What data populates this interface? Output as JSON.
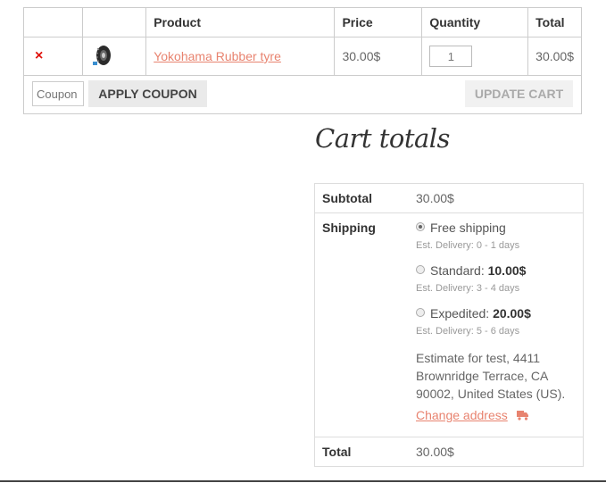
{
  "cart": {
    "headers": {
      "remove": "",
      "thumbnail": "",
      "product": "Product",
      "price": "Price",
      "quantity": "Quantity",
      "total": "Total"
    },
    "item": {
      "remove_symbol": "×",
      "thumbnail_icon": "tyre-icon",
      "product_name": "Yokohama Rubber tyre",
      "price": "30.00$",
      "quantity": "1",
      "total": "30.00$"
    },
    "actions": {
      "coupon_placeholder": "Coupon",
      "apply_coupon_label": "APPLY COUPON",
      "update_cart_label": "UPDATE CART"
    }
  },
  "totals": {
    "heading": "Cart totals",
    "subtotal_label": "Subtotal",
    "subtotal_value": "30.00$",
    "shipping_label": "Shipping",
    "shipping_options": [
      {
        "name": "Free shipping",
        "price": "",
        "delivery": "Est. Delivery: 0 - 1 days",
        "selected": true
      },
      {
        "name": "Standard:",
        "price": "10.00$",
        "delivery": "Est. Delivery: 3 - 4 days",
        "selected": false
      },
      {
        "name": "Expedited:",
        "price": "20.00$",
        "delivery": "Est. Delivery: 5 - 6 days",
        "selected": false
      }
    ],
    "estimate_text": "Estimate for test, 4411 Brownridge Terrace, CA 90002, United States (US).",
    "change_address_label": "Change address",
    "change_address_icon": "truck-icon",
    "total_label": "Total",
    "total_value": "30.00$"
  },
  "colors": {
    "link": "#e8836f",
    "remove": "#e0110a",
    "border": "#cccccc"
  }
}
